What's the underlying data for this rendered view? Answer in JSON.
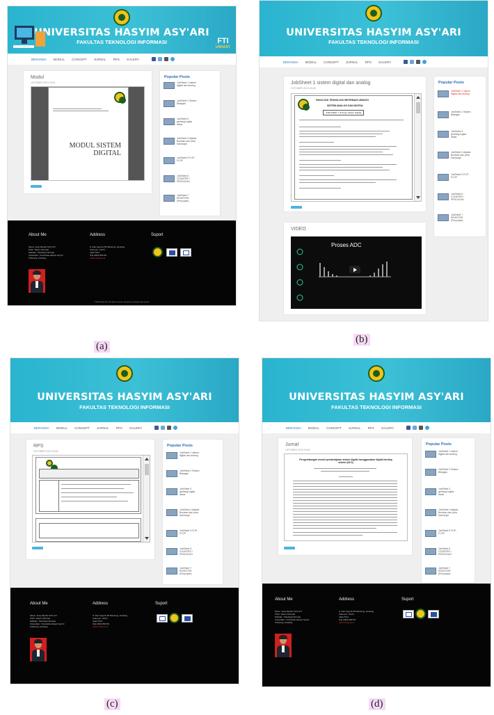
{
  "captions": [
    "(a)",
    "(b)",
    "(c)",
    "(d)"
  ],
  "site": {
    "university": "UNIVERSITAS HASYIM ASY'ARI",
    "faculty": "FAKULTAS TEKNOLOGI INFORMASI",
    "fti_badge": "FTI",
    "fti_sub": "UNHASY",
    "nav": [
      "BERANDA",
      "MODUL",
      "CONCEPT",
      "JURNAL",
      "RPS",
      "GALERY"
    ]
  },
  "panels": {
    "a": {
      "post_title": "Modul",
      "post_date": "OKTOBER 2019 09:41",
      "doc_text": "MODUL SISTEM DIGITAL",
      "popular_title": "Popular Posts",
      "popular": [
        "JobSheet 1 sistem digital dan analog",
        "JobSheet 2 Sistem Bilangan",
        "JobSheet 3 gerbang logika dasar",
        "JobSheet 4 Aljabar Boolean dan peta Karnaugh",
        "JobSheet 5 FLIP - FLOP",
        "JobSheet 6 COUNTER / PENCACAH",
        "JobSheet 7 REGISTER (Penyopan)"
      ],
      "about_me": "About Me",
      "address": "Address",
      "support": "Suport",
      "about_text": [
        "Nama : Andy Stevdin S.Pd.,M.T",
        "Profil : Dosen Informasi",
        "Fakultas : Teknologi Informasi",
        "Universitas : Universitas Hasyim Asy'Ari",
        "Tebuireng, Jombang"
      ],
      "address_text": [
        "Jl. Irian Jaya No.55 Tebuireng, Jombang",
        "Kode pos : 61471",
        "Jawa Timur",
        "Telp (0321) 861719",
        "www.unhasy.ac.id"
      ],
      "copyright": "© 2019 Andy Stev. All rights reserved. Design by: Labi dan open source"
    },
    "b": {
      "post_title": "JobSheet 1 sistem digital dan analog",
      "post_date": "OKTOBER 2019 09:48",
      "doc_header": "FAKULTAS TEKNOLOGI INFORMASI UNHASY",
      "doc_sub": "SISTEM ANALOG DAN DIGITAL",
      "doc_box": "JOB SHEET 1 (Konsep Sistem Digital)",
      "video_label": "VIDEO",
      "video_title": "Proses ADC",
      "popular_title": "Popular Posts",
      "popular": [
        "JobSheet 1 sistem digital dan analog",
        "JobSheet 2 Sistem Bilangan",
        "JobSheet 3 gerbang logika dasar",
        "JobSheet 4 Aljabar Boolean dan peta Karnaugh",
        "JobSheet 5 FLIP - FLOP",
        "JobSheet 6 COUNTER / PENCACAH",
        "JobSheet 7 REGISTER (Penyopan)"
      ]
    },
    "c": {
      "post_title": "RPS",
      "post_date": "OKTOBER 2019 09:50",
      "popular_title": "Popular Posts",
      "popular": [
        "JobSheet 1 sistem digital dan analog",
        "JobSheet 2 Sistem Bilangan",
        "JobSheet 3 gerbang logika dasar",
        "JobSheet 4 Aljabar Boolean dan peta Karnaugh",
        "JobSheet 5 FLIP - FLOP",
        "JobSheet 6 COUNTER / PENCACAH",
        "JobSheet 7 REGISTER (Penyopan)"
      ],
      "about_me": "About Me",
      "address": "Address",
      "support": "Suport"
    },
    "d": {
      "post_title": "Jurnal",
      "post_date": "OKTOBER 2019 09:52",
      "doc_title": "Pengembangan modul pembelajaran sistem digital menggunakan digital bsnisip sistem (DLS)",
      "popular_title": "Popular Posts",
      "popular": [
        "JobSheet 1 sistem digital dan analog",
        "JobSheet 2 Sistem Bilangan",
        "JobSheet 3 gerbang logika dasar",
        "JobSheet 4 Aljabar Boolean dan peta Karnaugh",
        "JobSheet 5 FLIP - FLOP",
        "JobSheet 6 COUNTER / PENCACAH",
        "JobSheet 7 REGISTER (Penyopan)"
      ],
      "about_me": "About Me",
      "address": "Address",
      "support": "Suport"
    }
  },
  "colors": {
    "header": "#2ab4cf",
    "link_active": "#2a7ab0",
    "popular_title": "#2a6fb5",
    "footer": "#050505",
    "accent_red": "#e03030"
  }
}
